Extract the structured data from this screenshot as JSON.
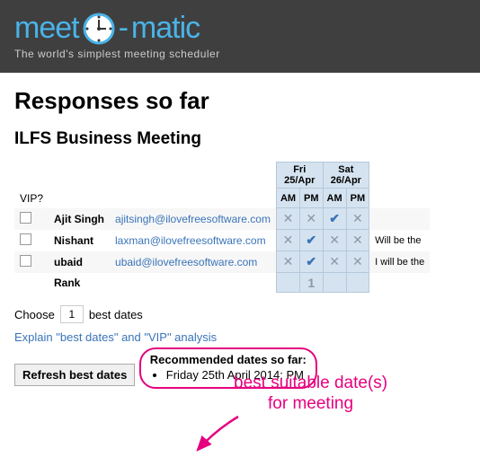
{
  "logo": {
    "meet": "meet",
    "matic": "matic"
  },
  "tagline": "The world's simplest meeting scheduler",
  "page_title": "Responses so far",
  "meeting_title": "ILFS Business Meeting",
  "vip_label": "VIP?",
  "dates": [
    {
      "day": "Fri",
      "date": "25/Apr"
    },
    {
      "day": "Sat",
      "date": "26/Apr"
    }
  ],
  "slot_labels": {
    "am": "AM",
    "pm": "PM"
  },
  "responses": [
    {
      "name": "Ajit Singh",
      "email": "ajitsingh@ilovefreesoftware.com",
      "slots": [
        "x",
        "x",
        "v",
        "x"
      ],
      "note": ""
    },
    {
      "name": "Nishant",
      "email": "laxman@ilovefreesoftware.com",
      "slots": [
        "x",
        "v",
        "x",
        "x"
      ],
      "note": "Will be the"
    },
    {
      "name": "ubaid",
      "email": "ubaid@ilovefreesoftware.com",
      "slots": [
        "x",
        "v",
        "x",
        "x"
      ],
      "note": "I will be the"
    }
  ],
  "rank_label": "Rank",
  "rank_values": [
    "",
    "1",
    "",
    ""
  ],
  "choose": {
    "pre": "Choose",
    "value": "1",
    "post": "best dates"
  },
  "explain_link": "Explain \"best dates\" and \"VIP\" analysis",
  "refresh_label": "Refresh best dates",
  "recommended": {
    "title": "Recommended dates so far:",
    "items": [
      "Friday 25th April 2014: PM"
    ]
  },
  "annotation": "best suitable date(s)\nfor meeting"
}
